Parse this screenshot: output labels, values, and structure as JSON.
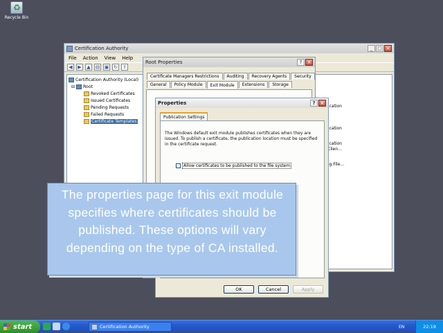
{
  "desktop": {
    "recycle_label": "Recycle Bin"
  },
  "ca_window": {
    "title": "Certification Authority",
    "menu": [
      "File",
      "Action",
      "View",
      "Help"
    ],
    "tree": [
      {
        "label": "Certification Authority (Local)"
      },
      {
        "label": "Root"
      },
      {
        "label": "Revoked Certificates"
      },
      {
        "label": "Issued Certificates"
      },
      {
        "label": "Pending Requests"
      },
      {
        "label": "Failed Requests"
      },
      {
        "label": "Certificate Templates"
      }
    ],
    "right_pane_fragments": [
      "entication",
      "entication",
      "entication",
      "al, Clien...",
      "pting File..."
    ]
  },
  "root_properties": {
    "title": "Root Properties",
    "tabs_row1": [
      "Certificate Managers Restrictions",
      "Auditing",
      "Recovery Agents",
      "Security"
    ],
    "tabs_row2": [
      "General",
      "Policy Module",
      "Exit Module",
      "Extensions",
      "Storage"
    ],
    "selected_tab": "Exit Module"
  },
  "properties_dialog": {
    "title": "Properties",
    "tab": "Publication Settings",
    "description": "The Windows default exit module publishes certificates when they are issued. To publish a certificate, the publication location must be specified in the certificate request.",
    "checkbox_label": "Allow certificates to be published to the file system",
    "checkbox_checked": false,
    "ok_label": "OK",
    "cancel_label": "Cancel",
    "apply_label": "Apply"
  },
  "callout": {
    "text": "The properties page for this exit module specifies where certificates should be published. These options will vary depending on the type of CA installed."
  },
  "taskbar": {
    "start_label": "start",
    "task_label": "Certification Authority",
    "language": "EN",
    "clock": "22:19"
  },
  "colors": {
    "callout_bg": "#a9c7ed",
    "taskbar": "#245acc",
    "start_button": "#2f8f2e"
  }
}
